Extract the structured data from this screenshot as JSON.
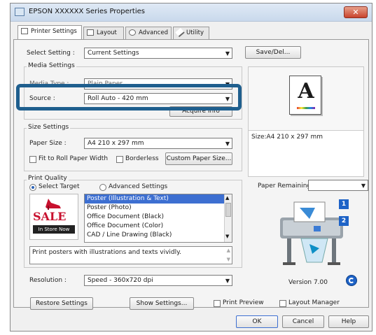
{
  "window": {
    "title": "EPSON XXXXXX Series Properties",
    "close_label": "✕"
  },
  "tabs": [
    {
      "label": "Printer Settings"
    },
    {
      "label": "Layout"
    },
    {
      "label": "Advanced"
    },
    {
      "label": "Utility"
    }
  ],
  "select_setting": {
    "label": "Select Setting :",
    "value": "Current Settings",
    "save_button": "Save/Del..."
  },
  "media_settings": {
    "group_label": "Media Settings",
    "media_type_label": "Media Type :",
    "media_type_value": "Plain Paper",
    "source_label": "Source :",
    "source_value": "Roll Auto - 420 mm",
    "acquire_button": "Acquire Info"
  },
  "size_settings": {
    "group_label": "Size Settings",
    "paper_size_label": "Paper Size :",
    "paper_size_value": "A4 210 x 297 mm",
    "fit_to_roll_label": "Fit to Roll Paper Width",
    "borderless_label": "Borderless",
    "custom_button": "Custom Paper Size..."
  },
  "preview": {
    "glyph": "A",
    "size_text": "Size:A4 210 x 297 mm"
  },
  "print_quality": {
    "group_label": "Print Quality",
    "select_target_label": "Select Target",
    "advanced_label": "Advanced Settings",
    "sale_text": "SALE",
    "in_store_text": "In Store Now",
    "targets": [
      "Poster (Illustration & Text)",
      "Poster (Photo)",
      "Office Document (Black)",
      "Office Document (Color)",
      "CAD / Line Drawing (Black)"
    ],
    "selected_index": 0,
    "description": "Print posters with illustrations and texts vividly."
  },
  "resolution": {
    "label": "Resolution :",
    "value": "Speed - 360x720 dpi"
  },
  "paper_remaining": {
    "label": "Paper Remaining :",
    "badge_1": "1",
    "badge_2": "2"
  },
  "version": "Version 7.00",
  "bottom": {
    "restore_button": "Restore Settings",
    "show_settings_button": "Show Settings...",
    "print_preview_label": "Print Preview",
    "layout_manager_label": "Layout Manager"
  },
  "footer": {
    "ok": "OK",
    "cancel": "Cancel",
    "help": "Help"
  },
  "colors": {
    "highlight": "#1f5f8e",
    "selection": "#3d6fd1",
    "sale_red": "#c8102e",
    "printer_badge": "#1e63c7"
  }
}
